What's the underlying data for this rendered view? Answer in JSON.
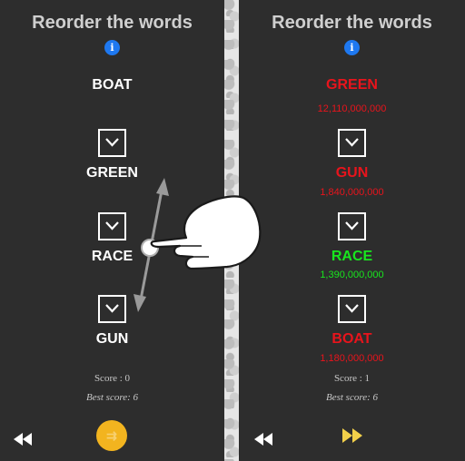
{
  "left": {
    "title": "Reorder the words",
    "words": [
      "BOAT",
      "GREEN",
      "RACE",
      "GUN"
    ],
    "score": "Score : 0",
    "best": "Best score: 6"
  },
  "right": {
    "title": "Reorder the words",
    "words": [
      {
        "label": "GREEN",
        "count": "12,110,000,000",
        "status": "wrong"
      },
      {
        "label": "GUN",
        "count": "1,840,000,000",
        "status": "wrong"
      },
      {
        "label": "RACE",
        "count": "1,390,000,000",
        "status": "correct"
      },
      {
        "label": "BOAT",
        "count": "1,180,000,000",
        "status": "wrong"
      }
    ],
    "score": "Score : 1",
    "best": "Best score: 6"
  },
  "icons": {
    "info": "info-icon",
    "swap": "chevron-down-icon",
    "back": "rewind-icon",
    "forward": "fast-forward-icon",
    "shuffle": "shuffle-icon",
    "hand": "pointing-hand-icon"
  },
  "colors": {
    "background": "#2d2d2d",
    "wrong": "#e8141c",
    "correct": "#18e61e",
    "info": "#1e78f0",
    "accent": "#f2b41f"
  }
}
